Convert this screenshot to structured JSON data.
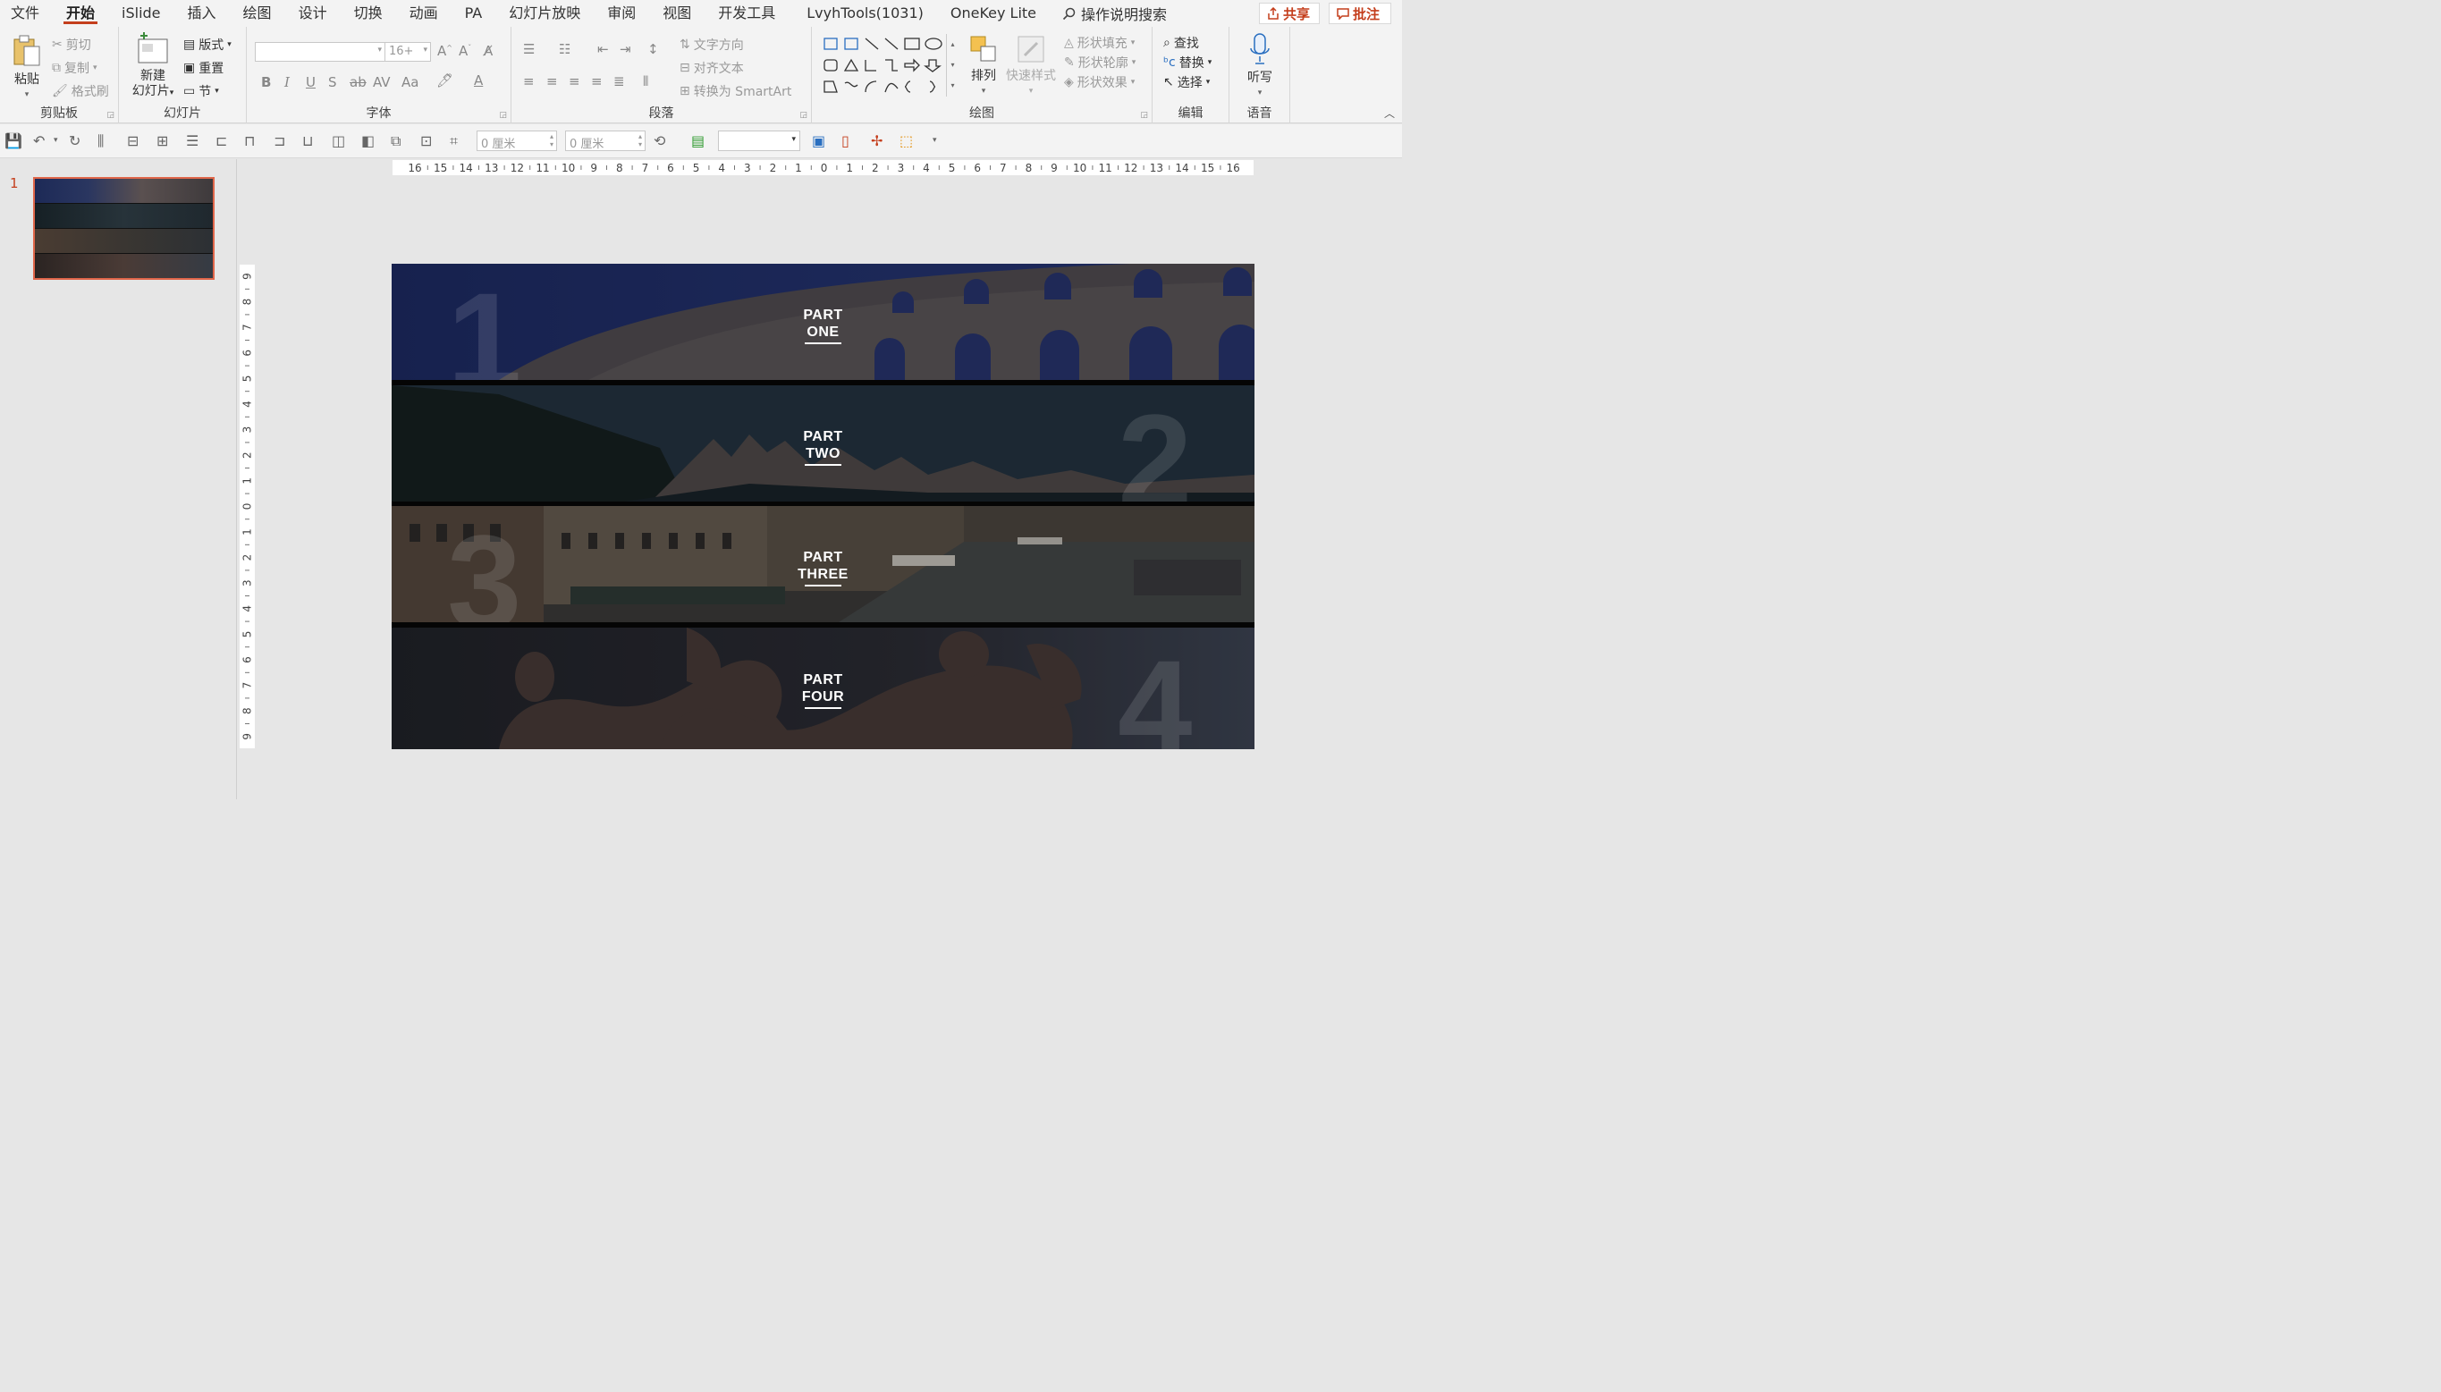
{
  "menu": {
    "items": [
      "文件",
      "开始",
      "iSlide",
      "插入",
      "绘图",
      "设计",
      "切换",
      "动画",
      "PA",
      "幻灯片放映",
      "审阅",
      "视图",
      "开发工具",
      "LvyhTools(1031)",
      "OneKey Lite"
    ],
    "active": "开始",
    "search": "操作说明搜索",
    "share": "共享",
    "comment": "批注"
  },
  "ribbon": {
    "clipboard": {
      "label": "剪贴板",
      "paste": "粘贴",
      "cut": "剪切",
      "copy": "复制",
      "format_painter": "格式刷"
    },
    "slides": {
      "label": "幻灯片",
      "new_slide_1": "新建",
      "new_slide_2": "幻灯片",
      "layout": "版式",
      "reset": "重置",
      "section": "节"
    },
    "font": {
      "label": "字体",
      "size": "16+"
    },
    "paragraph": {
      "label": "段落",
      "text_direction": "文字方向",
      "align_text": "对齐文本",
      "smartart": "转换为 SmartArt"
    },
    "drawing": {
      "label": "绘图",
      "arrange": "排列",
      "quick_styles": "快速样式",
      "fill": "形状填充",
      "outline": "形状轮廓",
      "effects": "形状效果"
    },
    "editing": {
      "label": "编辑",
      "find": "查找",
      "replace": "替换",
      "select": "选择"
    },
    "voice": {
      "label": "语音",
      "dictate": "听写"
    }
  },
  "qat": {
    "width": "0 厘米",
    "height": "0 厘米"
  },
  "slide_panel": {
    "number": "1"
  },
  "rulers": {
    "horizontal": [
      "16",
      "15",
      "14",
      "13",
      "12",
      "11",
      "10",
      "9",
      "8",
      "7",
      "6",
      "5",
      "4",
      "3",
      "2",
      "1",
      "0",
      "1",
      "2",
      "3",
      "4",
      "5",
      "6",
      "7",
      "8",
      "9",
      "10",
      "11",
      "12",
      "13",
      "14",
      "15",
      "16"
    ],
    "vertical": [
      "9",
      "8",
      "7",
      "6",
      "5",
      "4",
      "3",
      "2",
      "1",
      "0",
      "1",
      "2",
      "3",
      "4",
      "5",
      "6",
      "7",
      "8",
      "9"
    ]
  },
  "slide": {
    "parts": [
      {
        "line1": "PART",
        "line2": "ONE",
        "num": "1"
      },
      {
        "line1": "PART",
        "line2": "TWO",
        "num": "2"
      },
      {
        "line1": "PART",
        "line2": "THREE",
        "num": "3"
      },
      {
        "line1": "PART",
        "line2": "FOUR",
        "num": "4"
      }
    ]
  },
  "colors": {
    "accent": "#c43e1c",
    "thumb_border": "#e0664a"
  }
}
